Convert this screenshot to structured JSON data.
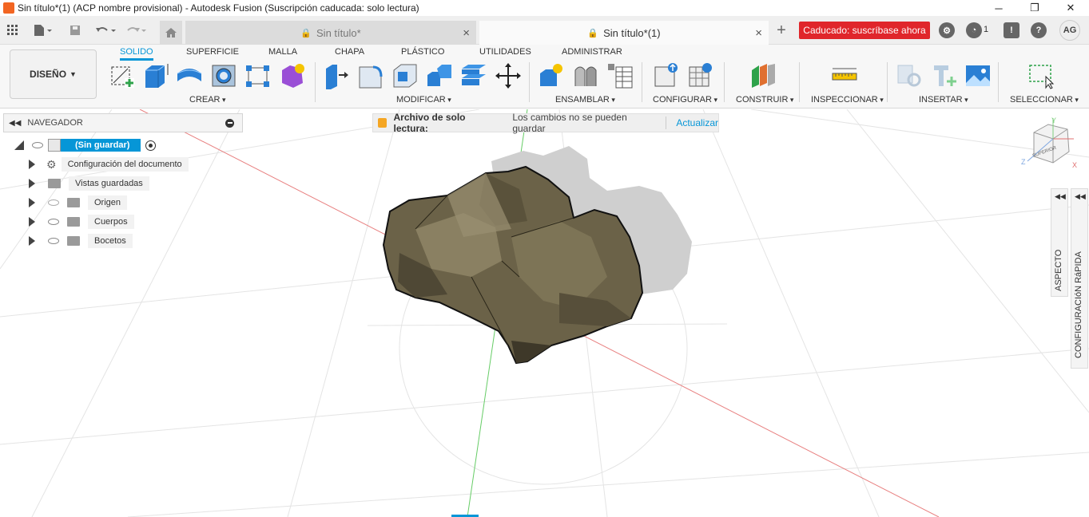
{
  "window": {
    "title": "Sin título*(1) (ACP nombre provisional) - Autodesk Fusion (Suscripción caducada: solo lectura)",
    "minimize": "─",
    "restore": "❐",
    "close": "✕"
  },
  "tabs": [
    {
      "label": "Sin título*",
      "close": "×"
    },
    {
      "label": "Sin título*(1)",
      "close": "×"
    }
  ],
  "tabbar": {
    "add": "+",
    "expired_label": "Caducado: suscríbase ahora",
    "jobs_count": "1",
    "user_initials": "AG"
  },
  "ribbon": {
    "design_label": "DISEÑO",
    "tabs": [
      "SOLIDO",
      "SUPERFICIE",
      "MALLA",
      "CHAPA",
      "PLÁSTICO",
      "UTILIDADES",
      "ADMINISTRAR"
    ],
    "groups": [
      "CREAR",
      "MODIFICAR",
      "ENSAMBLAR",
      "CONFIGURAR",
      "CONSTRUIR",
      "INSPECCIONAR",
      "INSERTAR",
      "SELECCIONAR"
    ]
  },
  "navigator": {
    "title": "NAVEGADOR",
    "root": "(Sin guardar)",
    "items": [
      "Configuración del documento",
      "Vistas guardadas",
      "Origen",
      "Cuerpos",
      "Bocetos"
    ]
  },
  "readonly": {
    "title": "Archivo de solo lectura:",
    "message": "Los cambios no se pueden guardar",
    "action": "Actualizar"
  },
  "viewcube": {
    "face": "SUPERIOR",
    "axis_x": "X",
    "axis_y": "Y",
    "axis_z": "Z"
  },
  "side": {
    "aspect": "ASPECTO",
    "quick": "CONFIGURACIóN RáPIDA"
  },
  "colors": {
    "accent": "#0696d7",
    "expired": "#e0262b",
    "rock": "#6b6248"
  }
}
